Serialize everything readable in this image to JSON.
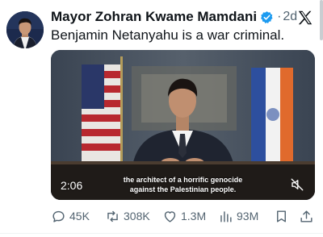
{
  "tweet": {
    "author_name": "Mayor Zohran Kwame Mamdani",
    "dot": "·",
    "time": "2d",
    "text": "Benjamin Netanyahu is a war criminal."
  },
  "media": {
    "caption_line1": "the architect of a horrific genocide",
    "caption_line2": "against the Palestinian people.",
    "video_time": "2:06"
  },
  "actions": {
    "replies": "45K",
    "reposts": "308K",
    "likes": "1.3M",
    "views": "93M"
  },
  "colors": {
    "text": "#0f1419",
    "muted": "#536471",
    "verified": "#1d9bf0"
  },
  "icons": [
    "verified-badge-icon",
    "x-logo-icon",
    "mute-icon",
    "reply-icon",
    "repost-icon",
    "like-icon",
    "views-icon",
    "bookmark-icon",
    "share-icon"
  ]
}
